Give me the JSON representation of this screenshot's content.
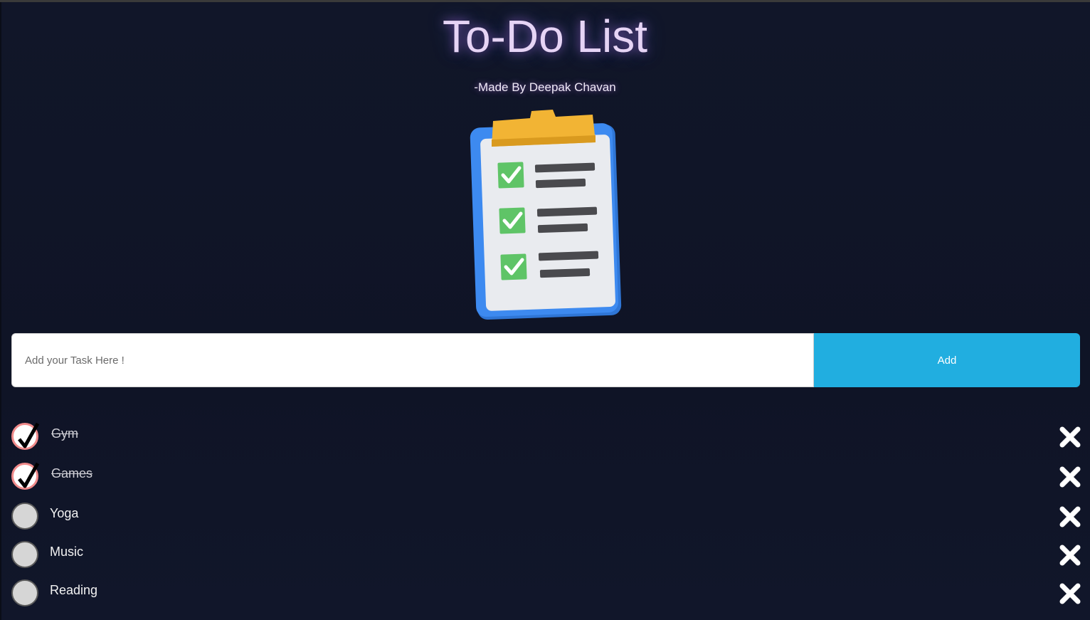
{
  "header": {
    "title": "To-Do List",
    "subtitle": "-Made By Deepak Chavan"
  },
  "illustration": {
    "icon": "clipboard-checklist-icon"
  },
  "form": {
    "placeholder": "Add your Task Here !",
    "value": "",
    "add_label": "Add"
  },
  "tasks": [
    {
      "label": "Gym",
      "done": true
    },
    {
      "label": "Games",
      "done": true
    },
    {
      "label": "Yoga",
      "done": false
    },
    {
      "label": "Music",
      "done": false
    },
    {
      "label": "Reading",
      "done": false
    }
  ],
  "colors": {
    "accent": "#21aee0",
    "background": "#111629",
    "title": "#e6d4f5",
    "checked_border": "#f08a8a"
  }
}
